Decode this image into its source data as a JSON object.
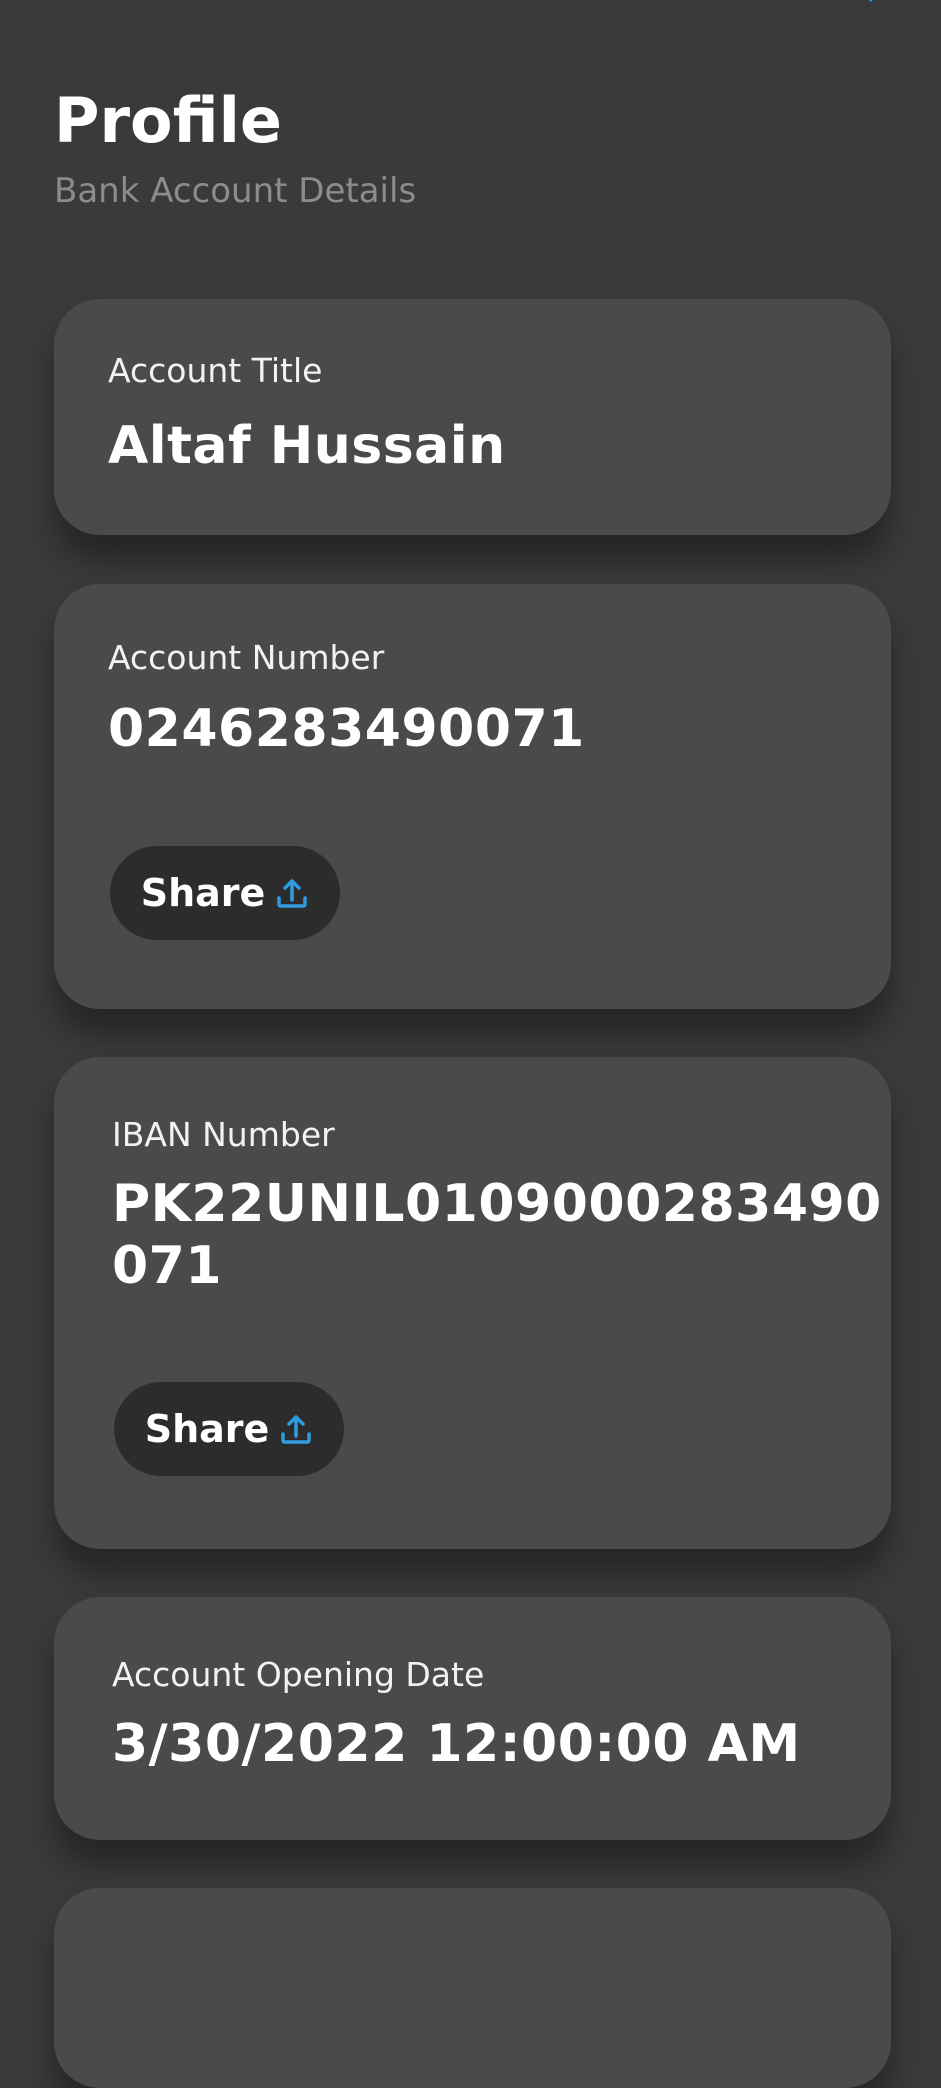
{
  "header": {
    "title": "Profile",
    "subtitle": "Bank Account Details"
  },
  "cards": {
    "account_title": {
      "label": "Account Title",
      "value": "Altaf Hussain"
    },
    "account_number": {
      "label": "Account Number",
      "value": "0246283490071",
      "share_label": "Share"
    },
    "iban": {
      "label": "IBAN Number",
      "value_line1": "PK22UNIL0109000283490",
      "value_line2": "071",
      "share_label": "Share"
    },
    "opening_date": {
      "label": "Account Opening Date",
      "value": "3/30/2022 12:00:00 AM"
    }
  },
  "icons": {
    "share": "share-upload-icon"
  },
  "colors": {
    "background": "#3a3a3a",
    "card": "#4a4a4a",
    "button": "#2c2c2c",
    "accent": "#2f9be0",
    "subtitle": "#8c8c8c"
  }
}
